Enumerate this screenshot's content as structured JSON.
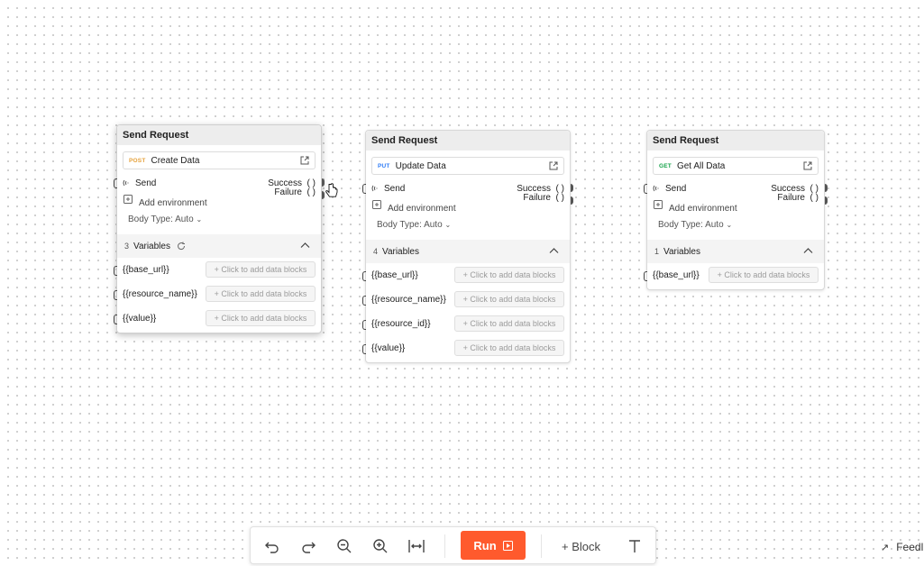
{
  "blocks": [
    {
      "title": "Send Request",
      "method": "POST",
      "request_name": "Create Data",
      "send": "Send",
      "success": "Success",
      "failure": "Failure",
      "paren": "( )",
      "add_env": "Add environment",
      "body_type": "Body Type: Auto",
      "var_count": "3",
      "variables_label": "Variables",
      "variables": [
        "{{base_url}}",
        "{{resource_name}}",
        "{{value}}"
      ],
      "add_label": "+ Click to add data blocks"
    },
    {
      "title": "Send Request",
      "method": "PUT",
      "request_name": "Update Data",
      "send": "Send",
      "success": "Success",
      "failure": "Failure",
      "paren": "( )",
      "add_env": "Add environment",
      "body_type": "Body Type: Auto",
      "var_count": "4",
      "variables_label": "Variables",
      "variables": [
        "{{base_url}}",
        "{{resource_name}}",
        "{{resource_id}}",
        "{{value}}"
      ],
      "add_label": "+ Click to add data blocks"
    },
    {
      "title": "Send Request",
      "method": "GET",
      "request_name": "Get All Data",
      "send": "Send",
      "success": "Success",
      "failure": "Failure",
      "paren": "( )",
      "add_env": "Add environment",
      "body_type": "Body Type: Auto",
      "var_count": "1",
      "variables_label": "Variables",
      "variables": [
        "{{base_url}}"
      ],
      "add_label": "+ Click to add data blocks"
    }
  ],
  "toolbar": {
    "run_label": "Run",
    "block_label": "+ Block",
    "icons": [
      "undo-icon",
      "redo-icon",
      "zoom-out-icon",
      "zoom-in-icon",
      "fit-width-icon",
      "text-icon"
    ]
  },
  "feedback_label": "Feedl",
  "colors": {
    "run": "#ff5a2d",
    "post": "#e6a23c",
    "put": "#2f7cf6",
    "get": "#16a34a"
  }
}
